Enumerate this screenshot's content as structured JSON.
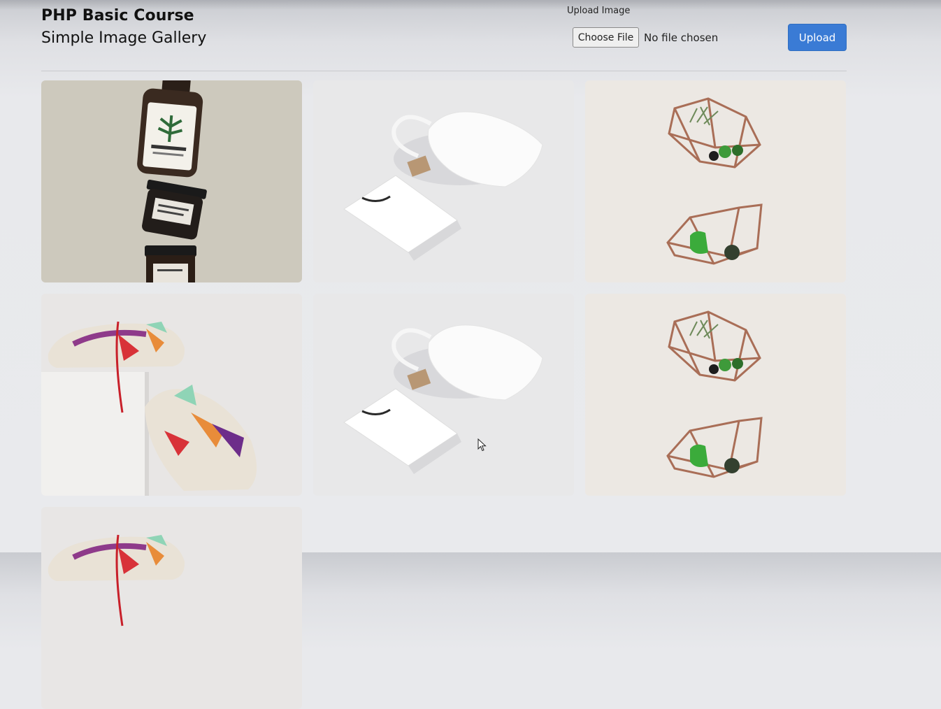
{
  "header": {
    "title": "PHP Basic Course",
    "subtitle": "Simple Image Gallery"
  },
  "upload_form": {
    "label": "Upload Image",
    "choose_file_label": "Choose File",
    "file_status": "No file chosen",
    "submit_label": "Upload"
  },
  "gallery": {
    "images": [
      {
        "subject": "stacked cosmetic jars and bottle",
        "photo": "jars"
      },
      {
        "subject": "white drawstring bag and shopping bag",
        "photo": "bags"
      },
      {
        "subject": "geometric copper terrarium shelves with plants",
        "photo": "terrarium"
      },
      {
        "subject": "colorful sneakers on white block",
        "photo": "sneakers"
      },
      {
        "subject": "white drawstring bag and shopping bag",
        "photo": "bags"
      },
      {
        "subject": "geometric copper terrarium shelves with plants",
        "photo": "terrarium"
      },
      {
        "subject": "colorful sneakers on white block",
        "photo": "sneakers"
      }
    ]
  }
}
